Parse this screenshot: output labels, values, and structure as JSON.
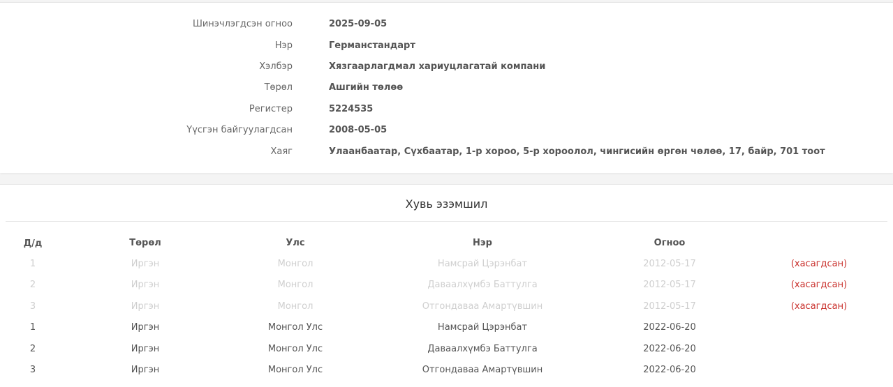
{
  "company": {
    "rows": [
      {
        "label": "Шинэчлэгдсэн огноо",
        "value": "2025-09-05"
      },
      {
        "label": "Нэр",
        "value": "Германстандарт"
      },
      {
        "label": "Хэлбэр",
        "value": "Хязгаарлагдмал хариуцлагатай компани"
      },
      {
        "label": "Төрөл",
        "value": "Ашгийн төлөө"
      },
      {
        "label": "Регистер",
        "value": "5224535"
      },
      {
        "label": "Үүсгэн байгуулагдсан",
        "value": "2008-05-05"
      },
      {
        "label": "Хаяг",
        "value": "Улаанбаатар, Сүхбаатар, 1-р хороо, 5-р хороолол, чингисийн өргөн чөлөө, 17, байр, 701 тоот"
      }
    ]
  },
  "ownership": {
    "title": "Хувь эзэмшил",
    "headers": {
      "index": "Д/д",
      "type": "Төрөл",
      "country": "Улс",
      "name": "Нэр",
      "date": "Огноо"
    },
    "rows": [
      {
        "index": "1",
        "type": "Иргэн",
        "country": "Монгол",
        "name": "Намсрай Цэрэнбат",
        "date": "2012-05-17",
        "status": "(хасагдсан)",
        "faded": true
      },
      {
        "index": "2",
        "type": "Иргэн",
        "country": "Монгол",
        "name": "Даваалхүмбэ Баттулга",
        "date": "2012-05-17",
        "status": "(хасагдсан)",
        "faded": true
      },
      {
        "index": "3",
        "type": "Иргэн",
        "country": "Монгол",
        "name": "Отгондаваа Амартүвшин",
        "date": "2012-05-17",
        "status": "(хасагдсан)",
        "faded": true
      },
      {
        "index": "1",
        "type": "Иргэн",
        "country": "Монгол Улс",
        "name": "Намсрай Цэрэнбат",
        "date": "2022-06-20",
        "status": "",
        "faded": false
      },
      {
        "index": "2",
        "type": "Иргэн",
        "country": "Монгол Улс",
        "name": "Даваалхүмбэ Баттулга",
        "date": "2022-06-20",
        "status": "",
        "faded": false
      },
      {
        "index": "3",
        "type": "Иргэн",
        "country": "Монгол Улс",
        "name": "Отгондаваа Амартүвшин",
        "date": "2022-06-20",
        "status": "",
        "faded": false
      }
    ]
  },
  "colors": {
    "removed": "#c9302c",
    "faded_text": "#cfcfcf",
    "text": "#555555"
  }
}
